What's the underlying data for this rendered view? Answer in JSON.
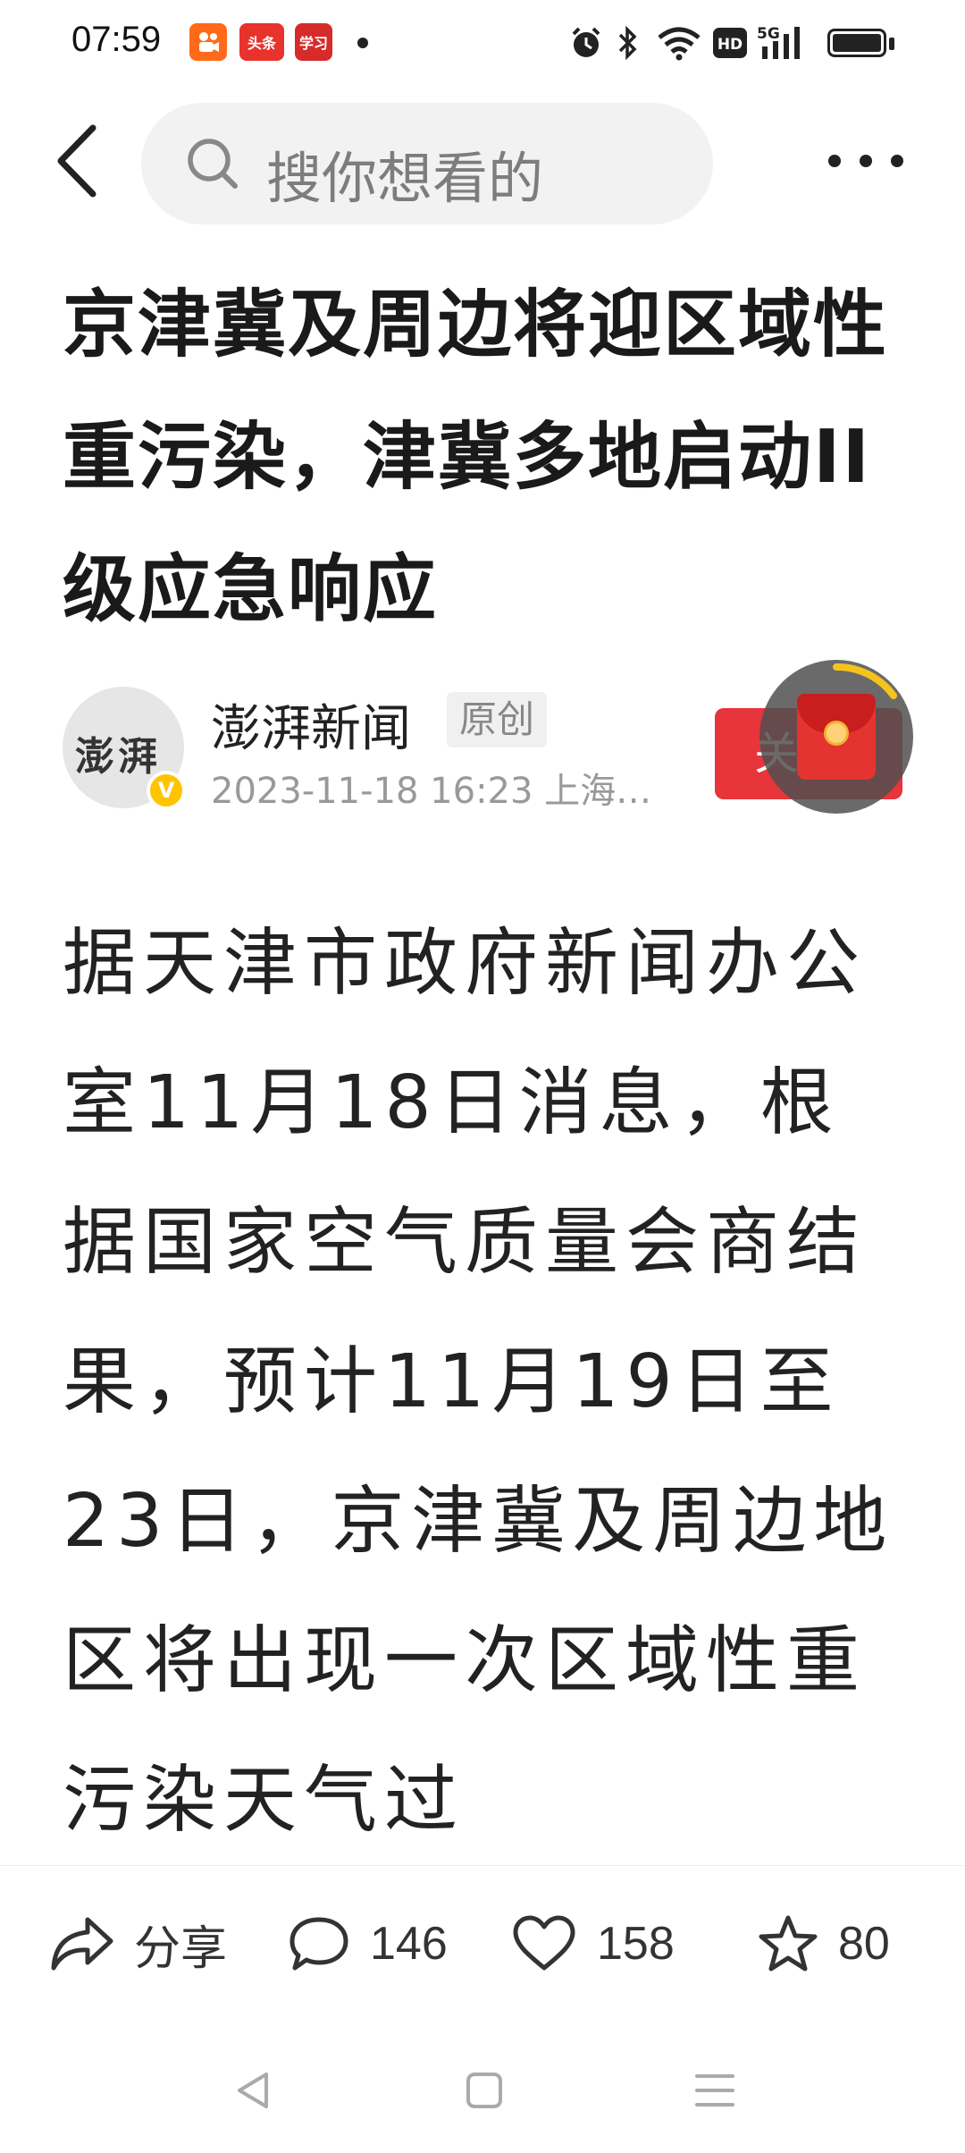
{
  "status_bar": {
    "time": "07:59",
    "app_icons": [
      "kuaishou-icon",
      "toutiao-icon",
      "xuexi-icon"
    ],
    "toutiao_label": "头条",
    "xuexi_label": "学习",
    "network_label": "5G",
    "hd_label": "HD",
    "system_icons": [
      "alarm-icon",
      "bluetooth-icon",
      "wifi-icon",
      "hd-icon",
      "signal-icon",
      "battery-icon"
    ]
  },
  "header": {
    "search_placeholder": "搜你想看的"
  },
  "article": {
    "title": "京津冀及周边将迎区域性重污染，津冀多地启动II级应急响应",
    "author": {
      "name": "澎湃新闻",
      "avatar_text": "澎湃",
      "verified_mark": "V",
      "tag": "原创",
      "meta": "2023-11-18  16:23  上海…"
    },
    "follow_label": "关注",
    "body": "据天津市政府新闻办公室11月18日消息，根据国家空气质量会商结果，预计11月19日至23日，京津冀及周边地区将出现一次区域性重污染天气过"
  },
  "actions": {
    "share_label": "分享",
    "comment_count": "146",
    "like_count": "158",
    "favorite_count": "80"
  },
  "colors": {
    "accent_red": "#e8343b",
    "badge_yellow": "#ffc400",
    "search_bg": "#f2f2f2"
  }
}
